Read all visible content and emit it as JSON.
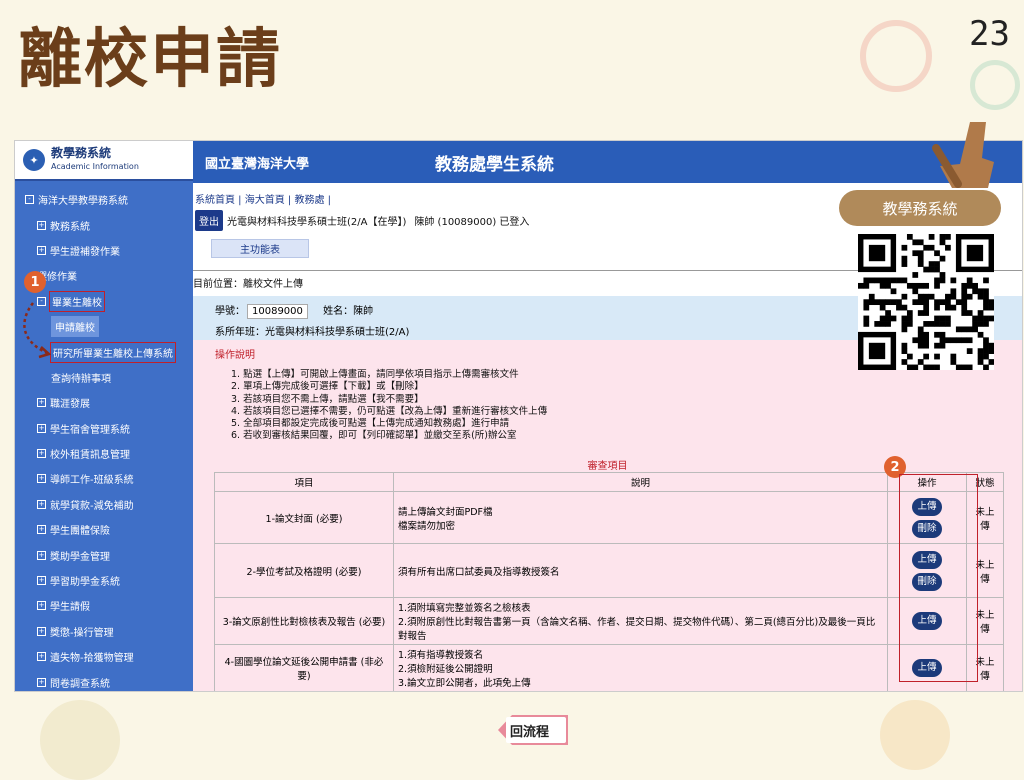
{
  "slide": {
    "title": "離校申請",
    "page_num": "23"
  },
  "sidebar": {
    "logo_title": "教學務系統",
    "logo_sub": "Academic Information",
    "items": [
      {
        "label": "海洋大學教學務系統",
        "box": "-",
        "sub": false
      },
      {
        "label": "教務系統",
        "box": "+",
        "sub": true
      },
      {
        "label": "學生證補發作業",
        "box": "+",
        "sub": true
      },
      {
        "label": "選修作業",
        "box": "",
        "sub": true
      },
      {
        "label": "畢業生離校",
        "box": "-",
        "sub": true,
        "hl": true
      },
      {
        "label": "申請離校",
        "box": "",
        "sub": true,
        "sel": true
      },
      {
        "label": "研究所畢業生離校上傳系統",
        "box": "",
        "sub": true,
        "hl": true
      },
      {
        "label": "查詢待辦事項",
        "box": "",
        "sub": true
      },
      {
        "label": "職涯發展",
        "box": "+",
        "sub": true
      },
      {
        "label": "學生宿舍管理系統",
        "box": "+",
        "sub": true
      },
      {
        "label": "校外租賃訊息管理",
        "box": "+",
        "sub": true
      },
      {
        "label": "導師工作-班級系統",
        "box": "+",
        "sub": true
      },
      {
        "label": "就學貸款-減免補助",
        "box": "+",
        "sub": true
      },
      {
        "label": "學生團體保險",
        "box": "+",
        "sub": true
      },
      {
        "label": "獎助學金管理",
        "box": "+",
        "sub": true
      },
      {
        "label": "學習助學金系統",
        "box": "+",
        "sub": true
      },
      {
        "label": "學生請假",
        "box": "+",
        "sub": true
      },
      {
        "label": "獎懲-操行管理",
        "box": "+",
        "sub": true
      },
      {
        "label": "遺失物-拾獲物管理",
        "box": "+",
        "sub": true
      },
      {
        "label": "問卷調查系統",
        "box": "+",
        "sub": true
      }
    ]
  },
  "badges": {
    "one": "1",
    "two": "2"
  },
  "banner": {
    "logo": "國立臺灣海洋大學",
    "title": "教務處學生系統"
  },
  "topnav": "系統首頁 | 海大首頁 | 教務處 |",
  "user": {
    "logout": "登出",
    "program": "光電與材料科技學系碩士班(2/A【在學】)",
    "name": "陳帥 (10089000) 已登入"
  },
  "mainmenu": "主功能表",
  "location": "目前位置：離校文件上傳",
  "info": {
    "sid_label": "學號：",
    "sid": "10089000",
    "name_label": "姓名：",
    "name": "陳帥",
    "dept": "系所年班：光電與材料科技學系碩士班(2/A)"
  },
  "instructions": {
    "title": "操作說明",
    "steps": [
      "1. 點選【上傳】可開啟上傳畫面，請同學依項目指示上傳需審核文件",
      "2. 單項上傳完成後可選擇【下載】或【刪除】",
      "3. 若該項目您不需上傳，請點選【我不需要】",
      "4. 若該項目您已選擇不需要，仍可點選【改為上傳】重新進行審核文件上傳",
      "5. 全部項目都設定完成後可點選【上傳完成通知教務處】進行申請",
      "6. 若收到審核結果回覆，即可【列印確認單】並繳交至系(所)辦公室"
    ]
  },
  "review": {
    "title": "審查項目",
    "headers": {
      "item": "項目",
      "desc": "說明",
      "op": "操作",
      "status": "狀態"
    },
    "upload": "上傳",
    "delete": "刪除",
    "rows": [
      {
        "item": "1-論文封面 (必要)",
        "desc": [
          "請上傳論文封面PDF檔",
          "檔案請勿加密"
        ],
        "del": true,
        "status": "未上傳"
      },
      {
        "item": "2-學位考試及格證明 (必要)",
        "desc": [
          "須有所有出席口試委員及指導教授簽名"
        ],
        "del": true,
        "status": "未上傳"
      },
      {
        "item": "3-論文原創性比對檢核表及報告 (必要)",
        "desc": [
          "1.須附填寫完整並簽名之檢核表",
          "2.須附原創性比對報告書第一頁（含論文名稱、作者、提交日期、提交物件代碼）、第二頁(總百分比)及最後一頁比對報告"
        ],
        "del": false,
        "status": "未上傳"
      },
      {
        "item": "4-國圖學位論文延後公開申請書 (非必要)",
        "desc": [
          "1.須有指導教授簽名",
          "2.須檢附延後公開證明",
          "3.論文立即公開者，此項免上傳"
        ],
        "del": false,
        "status": "未上傳"
      }
    ]
  },
  "qr_label": "教學務系統",
  "flow_button": "回流程",
  "colors": {
    "title": "#6b3e1a",
    "sidebar": "#3f6fc7",
    "banner": "#2a5db8",
    "pink": "#fde4ec",
    "accent": "#c0202a"
  }
}
